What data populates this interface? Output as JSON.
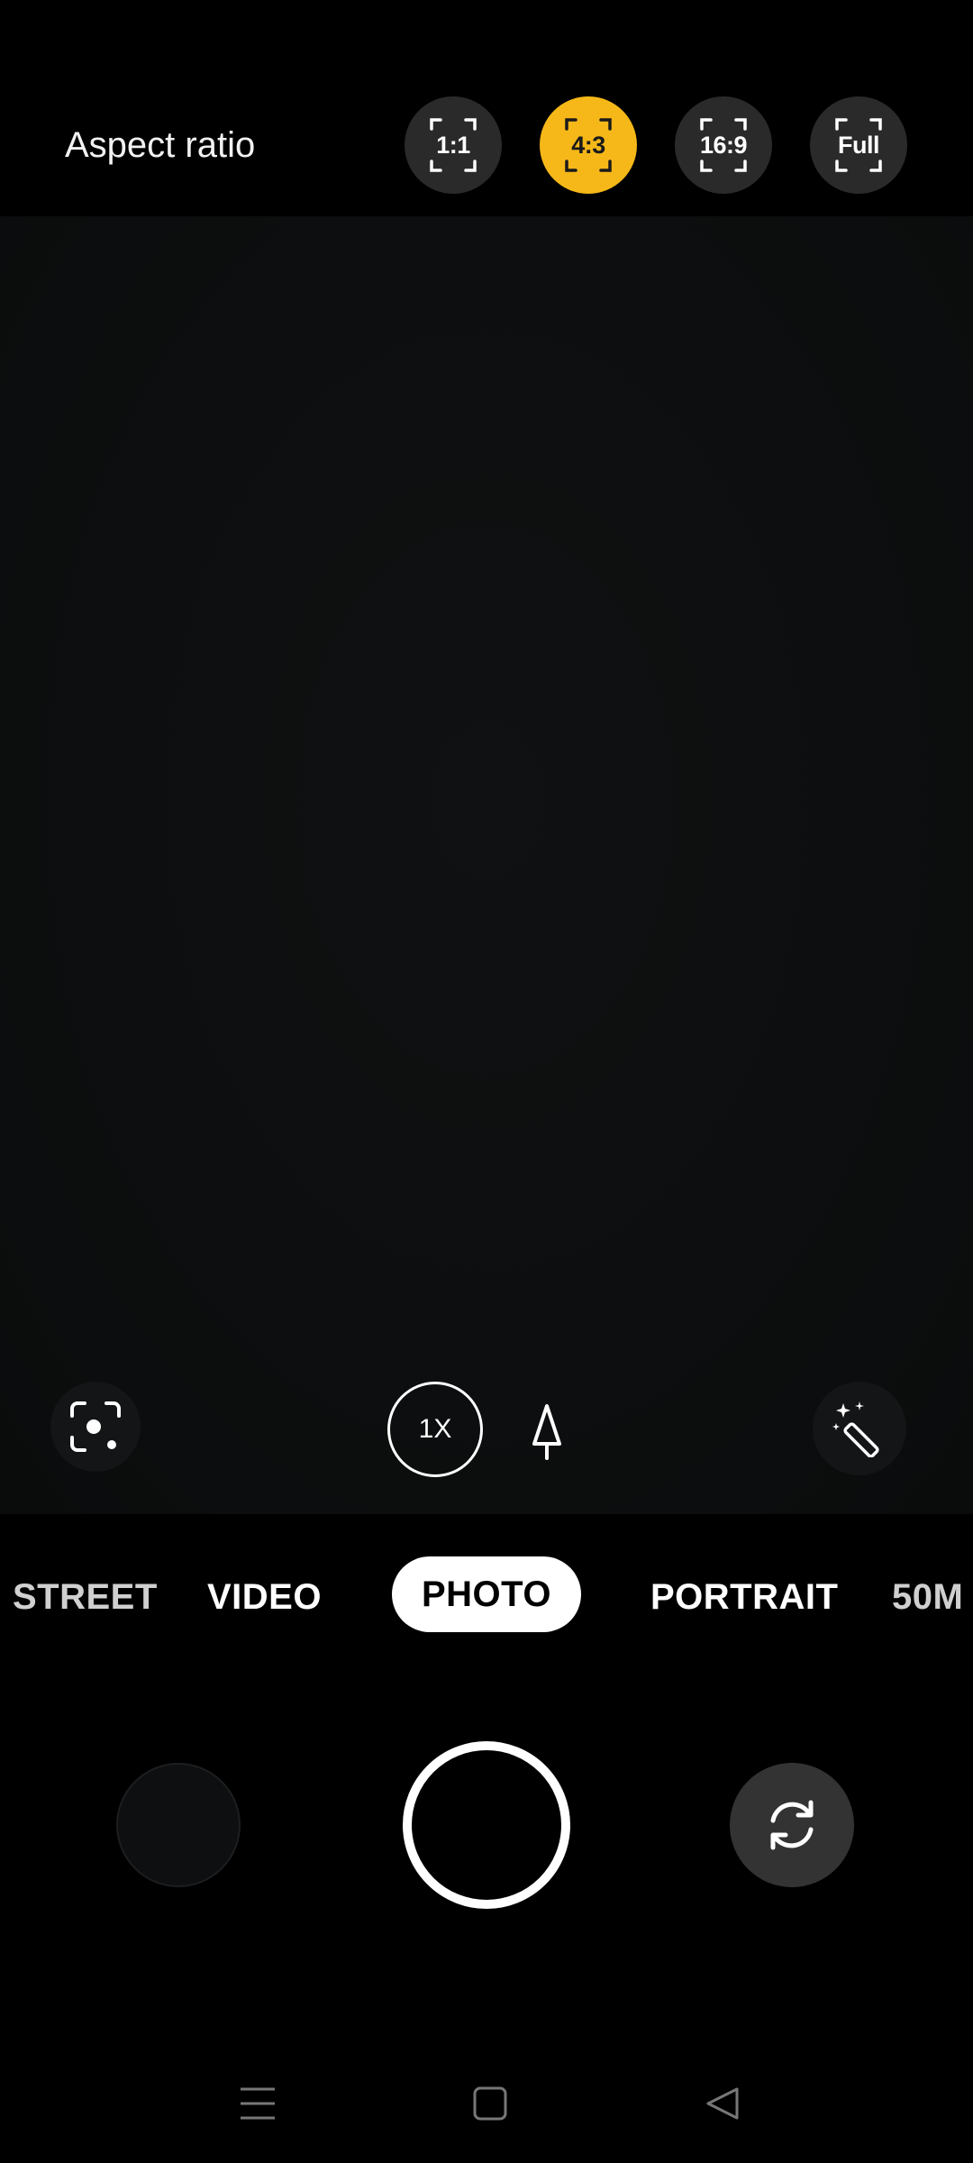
{
  "topbar": {
    "aspect_label": "Aspect ratio",
    "ratios": [
      {
        "label": "1:1",
        "active": false
      },
      {
        "label": "4:3",
        "active": true
      },
      {
        "label": "16:9",
        "active": false
      },
      {
        "label": "Full",
        "active": false
      }
    ]
  },
  "viewfinder": {
    "zoom_label": "1X",
    "icons": {
      "scan": "scan-lens-icon",
      "tree": "tree-icon",
      "magic": "magic-wand-icon"
    }
  },
  "modes": {
    "street": "STREET",
    "video": "VIDEO",
    "photo": "PHOTO",
    "portrait": "PORTRAIT",
    "fifty_m": "50M"
  },
  "colors": {
    "accent": "#f6b818",
    "background": "#000000",
    "button_bg": "#2a2a2a"
  }
}
